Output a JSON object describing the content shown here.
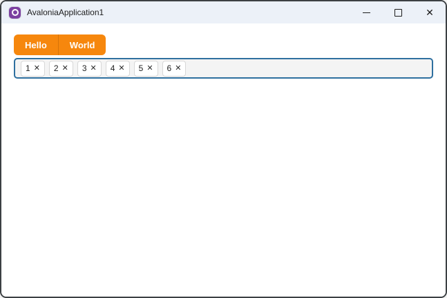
{
  "window": {
    "title": "AvaloniaApplication1",
    "controls": {
      "close_glyph": "✕"
    }
  },
  "tabs": {
    "items": [
      {
        "label": "Hello"
      },
      {
        "label": "World"
      }
    ],
    "accent_color": "#f6870d"
  },
  "chips": {
    "items": [
      {
        "label": "1"
      },
      {
        "label": "2"
      },
      {
        "label": "3"
      },
      {
        "label": "4"
      },
      {
        "label": "5"
      },
      {
        "label": "6"
      }
    ],
    "remove_glyph": "✕",
    "focus_border_color": "#2e6f9f"
  }
}
